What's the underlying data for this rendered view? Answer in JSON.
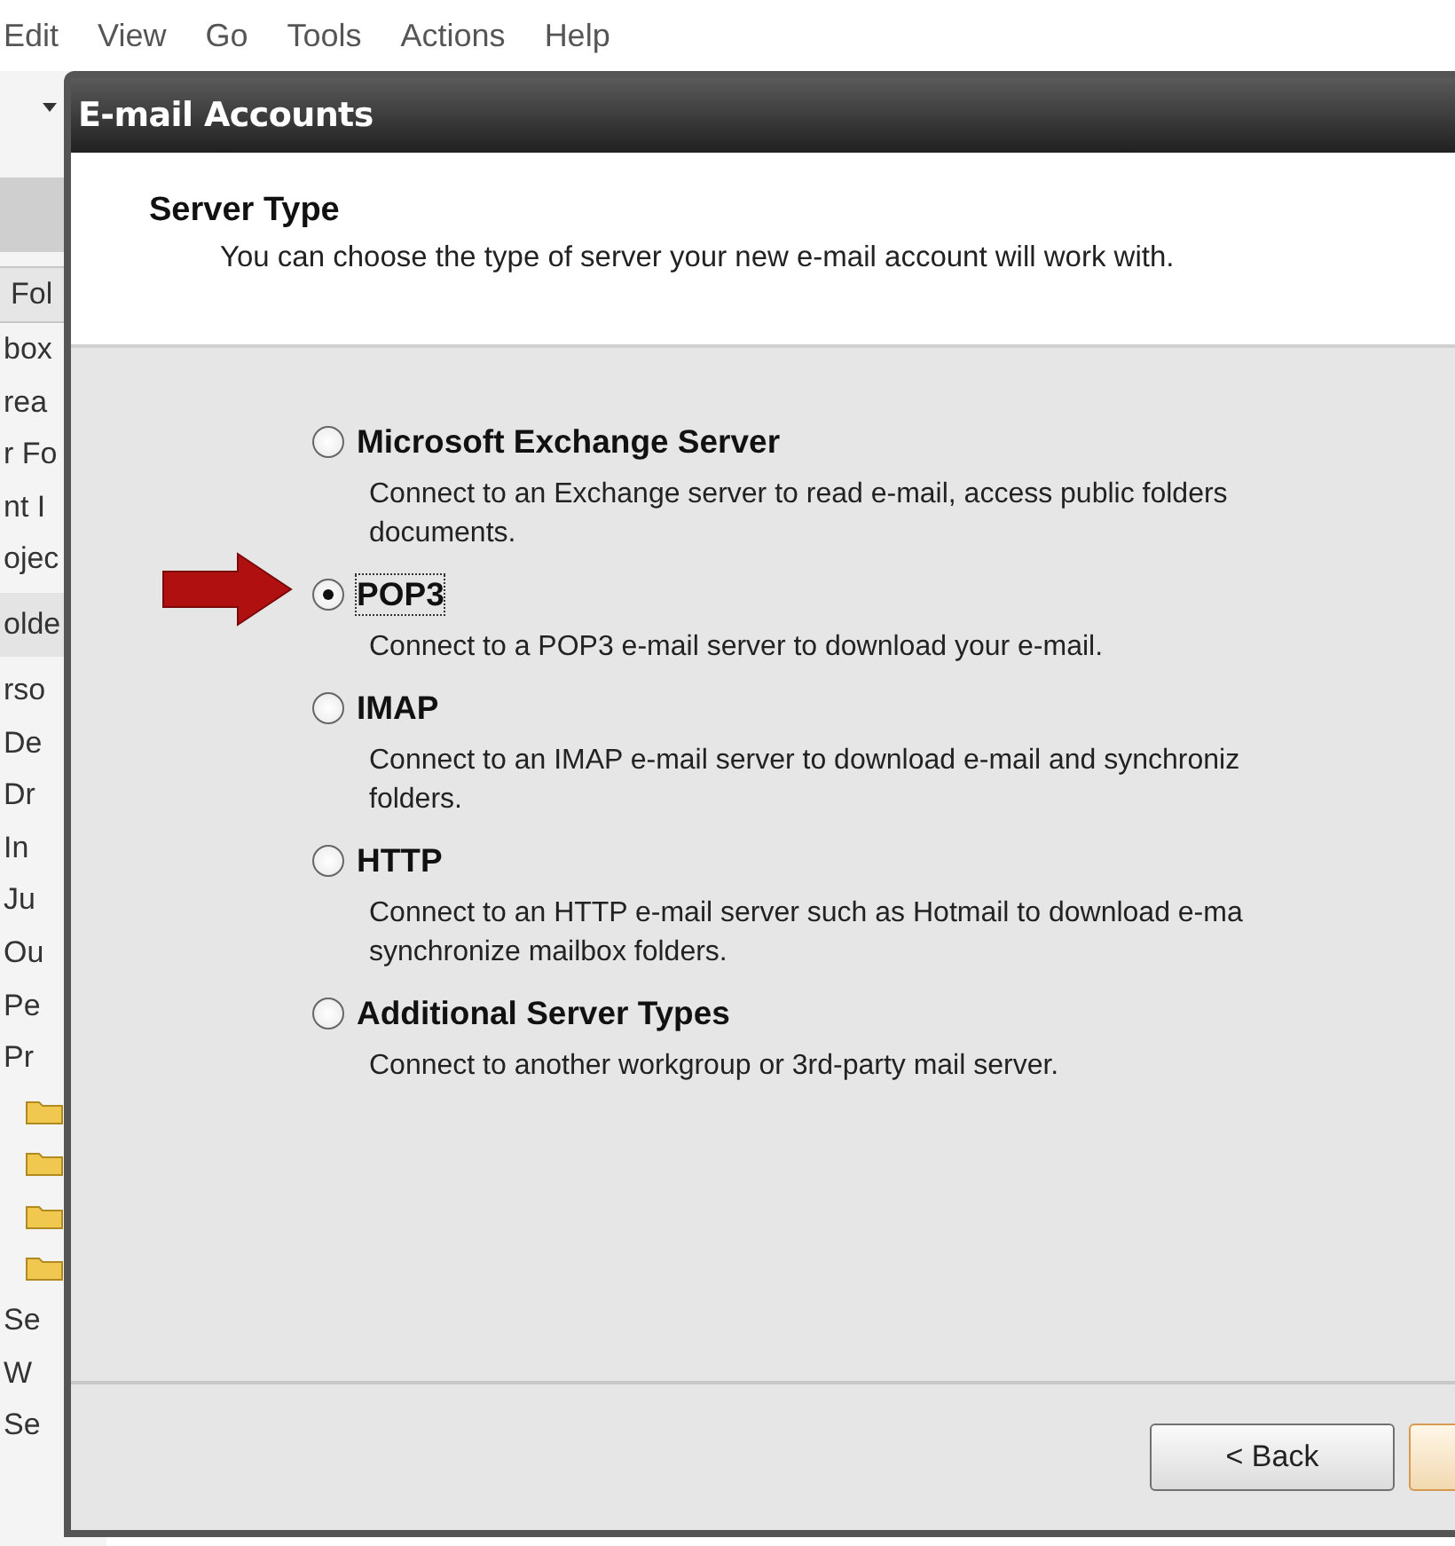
{
  "menu_bar": [
    "Edit",
    "View",
    "Go",
    "Tools",
    "Actions",
    "Help"
  ],
  "sidebar": {
    "header": "Fol",
    "items": [
      {
        "kind": "text",
        "label": "box"
      },
      {
        "kind": "text",
        "label": "rea"
      },
      {
        "kind": "text",
        "label": "r Fo"
      },
      {
        "kind": "text",
        "label": "nt I"
      },
      {
        "kind": "text",
        "label": "ojec"
      },
      {
        "kind": "section",
        "label": "olde"
      },
      {
        "kind": "text",
        "label": "rso"
      },
      {
        "kind": "text",
        "label": "De"
      },
      {
        "kind": "text",
        "label": "Dr"
      },
      {
        "kind": "text",
        "label": "In"
      },
      {
        "kind": "text",
        "label": "Ju"
      },
      {
        "kind": "text",
        "label": "Ou"
      },
      {
        "kind": "text",
        "label": "Pe"
      },
      {
        "kind": "text",
        "label": "Pr"
      },
      {
        "kind": "folder"
      },
      {
        "kind": "folder"
      },
      {
        "kind": "folder"
      },
      {
        "kind": "folder"
      },
      {
        "kind": "text",
        "label": "Se"
      },
      {
        "kind": "text",
        "label": "W"
      },
      {
        "kind": "text",
        "label": "Se"
      }
    ]
  },
  "dialog": {
    "title": "E-mail Accounts",
    "heading": "Server Type",
    "subtitle": "You can choose the type of server your new e-mail account will work with.",
    "options": [
      {
        "label": "Microsoft Exchange Server",
        "selected": false,
        "description": [
          "Connect to an Exchange server to read e-mail, access public folders",
          "documents."
        ]
      },
      {
        "label": "POP3",
        "selected": true,
        "description": [
          "Connect to a POP3 e-mail server to download your e-mail."
        ]
      },
      {
        "label": "IMAP",
        "selected": false,
        "description": [
          "Connect to an IMAP e-mail server to download e-mail and synchroniz",
          "folders."
        ]
      },
      {
        "label": "HTTP",
        "selected": false,
        "description": [
          "Connect to an HTTP e-mail server such as Hotmail to download e-ma",
          "synchronize mailbox folders."
        ]
      },
      {
        "label": "Additional Server Types",
        "selected": false,
        "description": [
          "Connect to another workgroup or 3rd-party mail server."
        ]
      }
    ],
    "back_button": "< Back"
  }
}
